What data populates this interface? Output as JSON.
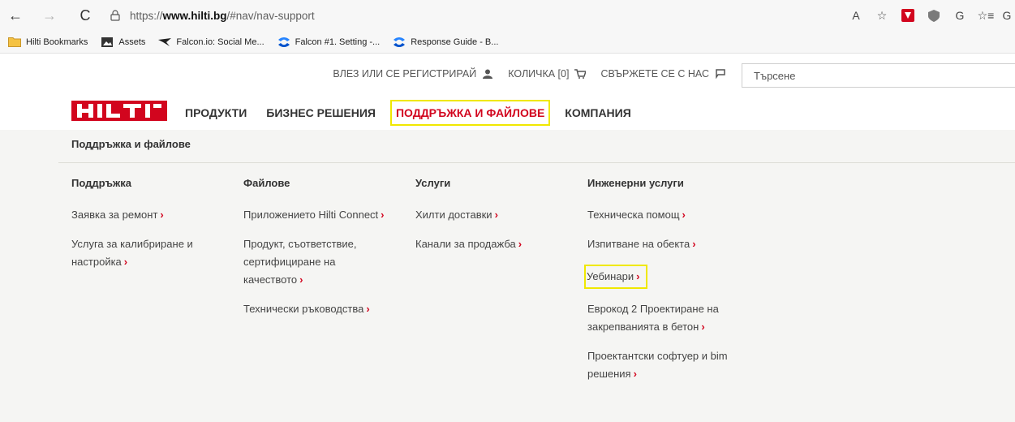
{
  "browser": {
    "back_icon": "←",
    "forward_icon": "→",
    "refresh_icon": "C",
    "url_prefix": "https://",
    "url_host": "www.hilti.bg",
    "url_path": "/#nav/nav-support",
    "ext_read_aloud": "A",
    "ext_favorite": "☆",
    "ext_collections": "G",
    "ext_favorites_bar": "☆≡",
    "ext_more": "G"
  },
  "bookmarks": [
    {
      "label": "Hilti Bookmarks",
      "icon": "folder-icon"
    },
    {
      "label": "Assets",
      "icon": "image-icon"
    },
    {
      "label": "Falcon.io: Social Me...",
      "icon": "falcon-icon"
    },
    {
      "label": "Falcon #1. Setting -...",
      "icon": "confluence-icon"
    },
    {
      "label": "Response Guide - B...",
      "icon": "confluence-icon"
    }
  ],
  "utility": {
    "login": "ВЛЕЗ ИЛИ СЕ РЕГИСТРИРАЙ",
    "cart": "КОЛИЧКА [0]",
    "contact": "СВЪРЖЕТЕ СЕ С НАС",
    "search_placeholder": "Търсене"
  },
  "nav": {
    "logo_text": "HILTI",
    "products": "ПРОДУКТИ",
    "business": "БИЗНЕС РЕШЕНИЯ",
    "support": "ПОДДРЪЖКА И ФАЙЛОВЕ",
    "company": "КОМПАНИЯ"
  },
  "mega": {
    "heading": "Поддръжка и файлове",
    "chevron": "›",
    "columns": [
      {
        "title": "Поддръжка",
        "items": [
          "Заявка за ремонт",
          "Услуга за калибриране и настройка"
        ]
      },
      {
        "title": "Файлове",
        "items": [
          "Приложението Hilti Connect",
          "Продукт, съответствие, сертифициране на качеството",
          "Технически ръководства"
        ]
      },
      {
        "title": "Услуги",
        "items": [
          "Хилти доставки",
          "Канали за продажба"
        ]
      },
      {
        "title": "Инженерни услуги",
        "items": [
          "Техническа помощ",
          "Изпитване на обекта",
          "Уебинари",
          "Еврокод 2 Проектиране на закрепванията в бетон",
          "Проектантски софтуер и bim решения"
        ]
      }
    ]
  },
  "colors": {
    "accent": "#d2051e",
    "highlight": "#f0e800"
  }
}
